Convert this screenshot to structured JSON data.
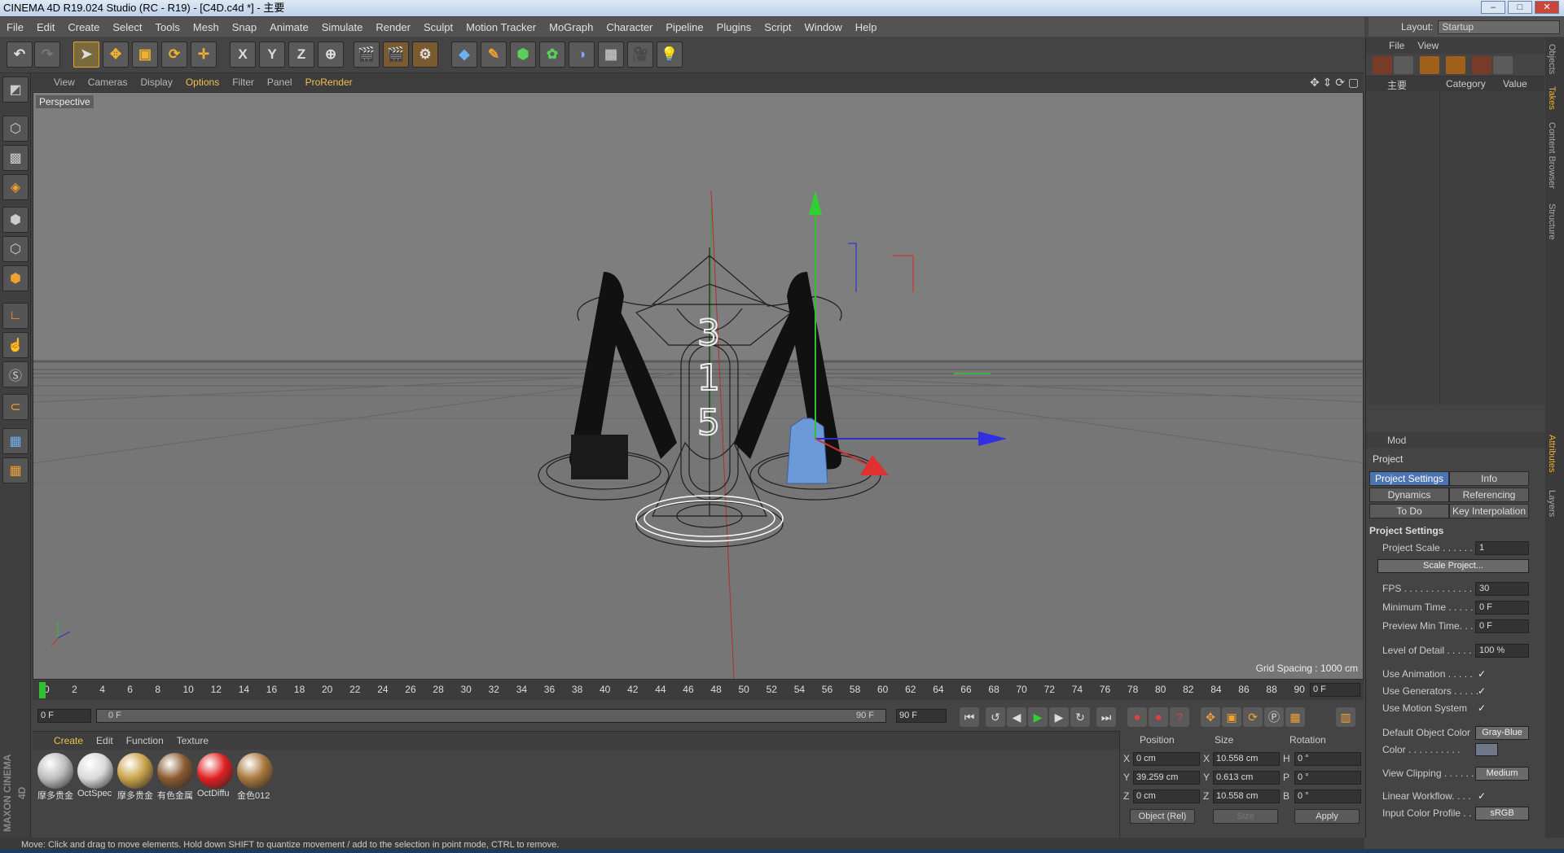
{
  "window": {
    "title": "CINEMA 4D R19.024 Studio (RC - R19) - [C4D.c4d *] - 主要",
    "min": "–",
    "max": "□",
    "close": "✕"
  },
  "menu": [
    "File",
    "Edit",
    "Create",
    "Select",
    "Tools",
    "Mesh",
    "Snap",
    "Animate",
    "Simulate",
    "Render",
    "Sculpt",
    "Motion Tracker",
    "MoGraph",
    "Character",
    "Pipeline",
    "Plugins",
    "Script",
    "Window",
    "Help"
  ],
  "layout": {
    "label": "Layout:",
    "value": "Startup"
  },
  "toolbar": {
    "x": "X",
    "y": "Y",
    "z": "Z"
  },
  "viewport": {
    "menu": [
      "View",
      "Cameras",
      "Display",
      "Options",
      "Filter",
      "Panel",
      "ProRender"
    ],
    "camera": "Perspective",
    "grid_spacing": "Grid Spacing : 1000 cm",
    "numbers": [
      "3",
      "1",
      "5"
    ]
  },
  "timeline": {
    "ticks": [
      "0",
      "2",
      "4",
      "6",
      "8",
      "10",
      "12",
      "14",
      "16",
      "18",
      "20",
      "22",
      "24",
      "26",
      "28",
      "30",
      "32",
      "34",
      "36",
      "38",
      "40",
      "42",
      "44",
      "46",
      "48",
      "50",
      "52",
      "54",
      "56",
      "58",
      "60",
      "62",
      "64",
      "66",
      "68",
      "70",
      "72",
      "74",
      "76",
      "78",
      "80",
      "82",
      "84",
      "86",
      "88",
      "90"
    ],
    "current_frame": "0 F",
    "start": "0 F",
    "range_start": "0 F",
    "range_end": "90 F",
    "end": "90 F"
  },
  "materials": {
    "menu": [
      "Create",
      "Edit",
      "Function",
      "Texture"
    ],
    "items": [
      {
        "name": "摩多贵金",
        "color": "#bdbdbd"
      },
      {
        "name": "OctSpec",
        "color": "#d9d9d9"
      },
      {
        "name": "摩多贵金",
        "color": "#c9a24a"
      },
      {
        "name": "有色金属",
        "color": "#8a5a30"
      },
      {
        "name": "OctDiffu",
        "color": "#e02020"
      },
      {
        "name": "金色012",
        "color": "#a8773c"
      }
    ]
  },
  "coordinates": {
    "headers": {
      "position": "Position",
      "size": "Size",
      "rotation": "Rotation"
    },
    "pos": {
      "x": "0 cm",
      "y": "39.259 cm",
      "z": "0 cm"
    },
    "size": {
      "x": "10.558 cm",
      "y": "0.613 cm",
      "z": "10.558 cm"
    },
    "rot": {
      "h": "0 °",
      "p": "0 °",
      "b": "0 °"
    },
    "axis_x": "X",
    "axis_y": "Y",
    "axis_z": "Z",
    "axis_h": "H",
    "axis_p": "P",
    "axis_b": "B",
    "mode": "Object (Rel)",
    "size_mode": "Size",
    "apply": "Apply"
  },
  "status": "Move: Click and drag to move elements. Hold down SHIFT to quantize movement / add to the selection in point mode, CTRL to remove.",
  "brand": "MAXON CINEMA 4D",
  "objects": {
    "menu": [
      "File",
      "View"
    ],
    "root_item": "主要",
    "col_category": "Category",
    "col_value": "Value"
  },
  "attributes": {
    "mode_label": "Mod",
    "title": "Project",
    "tabs": [
      "Project Settings",
      "Info",
      "Dynamics",
      "Referencing",
      "To Do",
      "Key Interpolation"
    ],
    "section": "Project Settings",
    "project_scale_label": "Project Scale . . . . . . .",
    "project_scale": "1",
    "scale_project_btn": "Scale Project...",
    "fps_label": "FPS . . . . . . . . . . . . . . .",
    "fps": "30",
    "min_time_label": "Minimum Time . . . . .",
    "min_time": "0 F",
    "preview_min_label": "Preview Min Time. . .",
    "preview_min": "0 F",
    "lod_label": "Level of Detail . . . . . .",
    "lod": "100 %",
    "use_anim_label": "Use Animation . . . . .",
    "use_gen_label": "Use Generators . . . . .",
    "use_motion_label": "Use Motion System",
    "check": "✓",
    "default_color_label": "Default Object Color",
    "default_color": "Gray-Blue",
    "color_label": "Color . . . . . . . . . .",
    "view_clip_label": "View Clipping . . . . . .",
    "view_clip": "Medium",
    "linear_label": "Linear Workflow. . . .",
    "input_profile_label": "Input Color Profile . .",
    "input_profile": "sRGB"
  },
  "side_tabs": [
    "Objects",
    "Takes",
    "Content Browser",
    "Structure",
    "Attributes",
    "Layers"
  ]
}
